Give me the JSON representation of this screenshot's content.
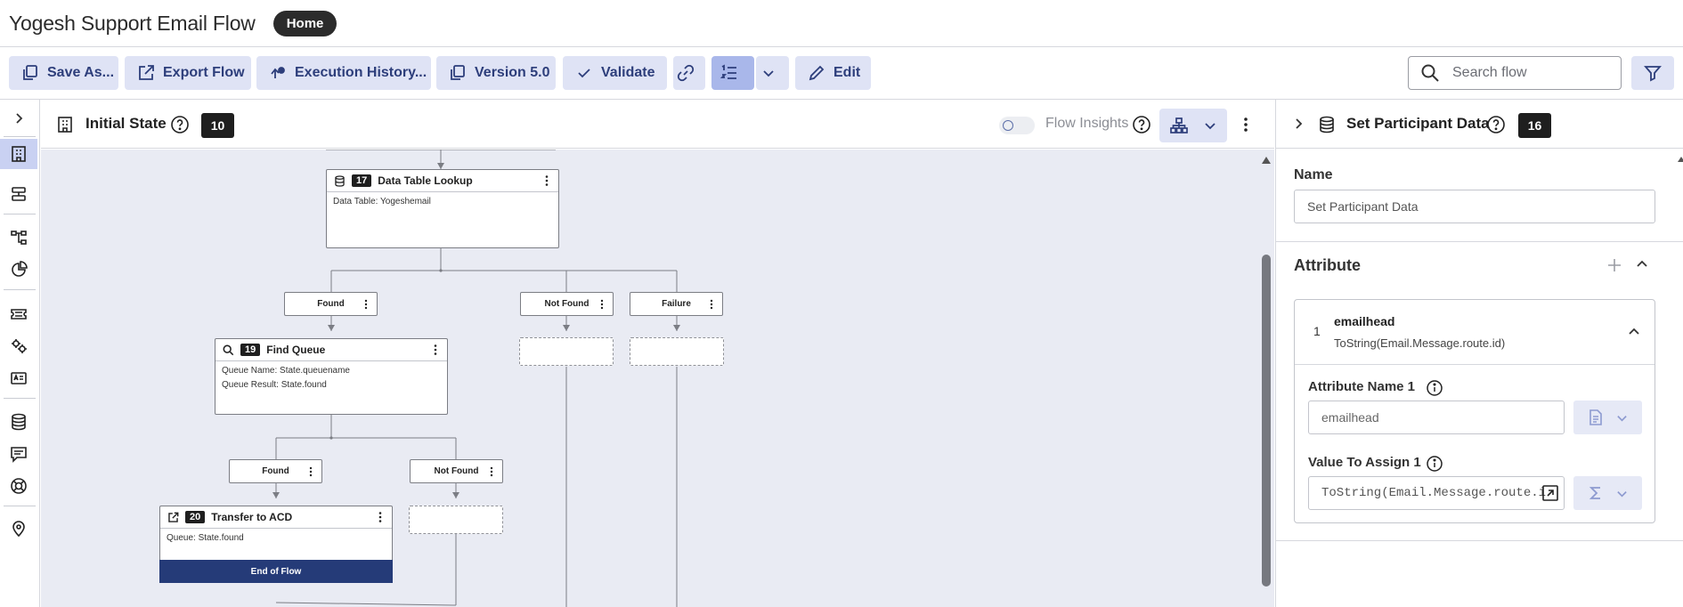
{
  "header": {
    "title": "Yogesh Support Email Flow",
    "badge": "Home"
  },
  "toolbar": {
    "save_as": "Save As...",
    "export_flow": "Export Flow",
    "execution_history": "Execution History...",
    "version": "Version 5.0",
    "validate": "Validate",
    "edit": "Edit",
    "search_placeholder": "Search flow"
  },
  "canvas_header": {
    "state_title": "Initial State",
    "state_count": "10",
    "flow_insights": "Flow Insights"
  },
  "nodes": {
    "lookup": {
      "number": "17",
      "title": "Data Table Lookup",
      "line1": "Data Table: Yogeshemail"
    },
    "find_queue": {
      "number": "19",
      "title": "Find Queue",
      "line1": "Queue Name: State.queuename",
      "line2": "Queue Result: State.found"
    },
    "transfer": {
      "number": "20",
      "title": "Transfer to ACD",
      "line1": "Queue: State.found",
      "end_label": "End of Flow"
    }
  },
  "outcomes": {
    "lookup_found": "Found",
    "lookup_not_found": "Not Found",
    "lookup_failure": "Failure",
    "queue_found": "Found",
    "queue_not_found": "Not Found"
  },
  "panel": {
    "title": "Set Participant Data",
    "count": "16",
    "name_label": "Name",
    "name_value": "Set Participant Data",
    "attribute_section": "Attribute",
    "attribute": {
      "index": "1",
      "name": "emailhead",
      "expression": "ToString(Email.Message.route.id)",
      "name_field_label": "Attribute Name 1",
      "name_field_value": "emailhead",
      "value_field_label": "Value To Assign 1",
      "value_field_value": "ToString(Email.Message.route.i"
    }
  },
  "colors": {
    "toolbar_button_bg": "#dfe3f5",
    "toolbar_button_text": "#2d3e7b",
    "active_button_bg": "#a9b7ea",
    "canvas_bg": "#e9ebf3",
    "end_of_flow_bg": "#253b78"
  }
}
